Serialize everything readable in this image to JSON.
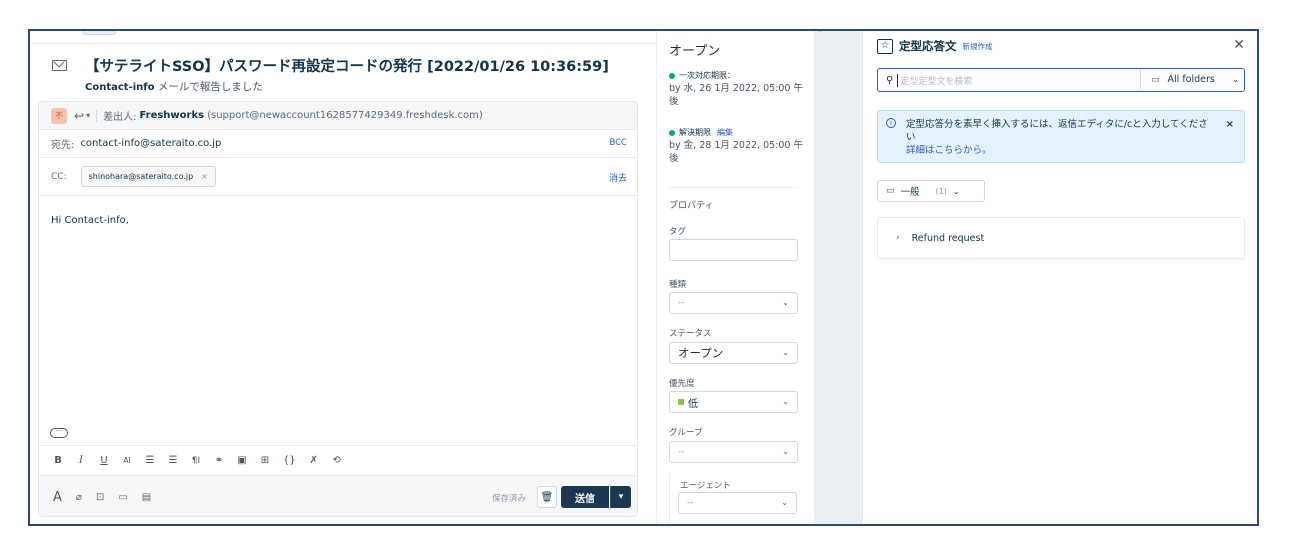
{
  "email": {
    "subject": "【サテライトSSO】パスワード再設定コードの発行 [2022/01/26 10:36:59]",
    "contact_name": "Contact-info",
    "contact_note": "メールで報告しました",
    "avatar_initials": "不",
    "from_label": "差出人:",
    "from_name": "Freshworks",
    "from_email": "(support@newaccount1628577429349.freshdesk.com)",
    "to_label": "宛先:",
    "to_value": "contact-info@sateraito.co.jp",
    "bcc_label": "BCC",
    "cc_label": "CC:",
    "cc_chip": "shinohara@sateraito.co.jp",
    "clear_label": "消去",
    "body": "Hi Contact-info,",
    "saved_label": "保存済み",
    "send_label": "送信"
  },
  "properties": {
    "status_title": "オープン",
    "first_response_label": "一次対応期限：",
    "first_response_value": "by 水, 26 1月 2022, 05:00 午後",
    "resolution_label": "解決期限",
    "edit_label": "編集",
    "resolution_value": "by 金, 28 1月 2022, 05:00 午後",
    "section_title": "プロパティ",
    "tag_label": "タグ",
    "type_label": "種類",
    "type_value": "--",
    "status_label": "ステータス",
    "status_value": "オープン",
    "priority_label": "優先度",
    "priority_value": "低",
    "group_label": "グループ",
    "group_value": "--",
    "agent_label": "エージェント",
    "agent_value": "--"
  },
  "canned": {
    "title": "定型応答文",
    "new_link": "新規作成",
    "search_placeholder": "定型定型文を検索",
    "folder_filter": "All folders",
    "info_text": "定型応答分を素早く挿入するには、返信エディタに/cと入力してください",
    "info_link": "詳細はこちらから。",
    "folder_name": "一般",
    "folder_count": "(1)",
    "item_label": "Refund request"
  },
  "colors": {
    "accent": "#2c5cc5",
    "dark_button": "#1d3753",
    "frame_border": "#2c4a75",
    "success_dot": "#00a886"
  }
}
